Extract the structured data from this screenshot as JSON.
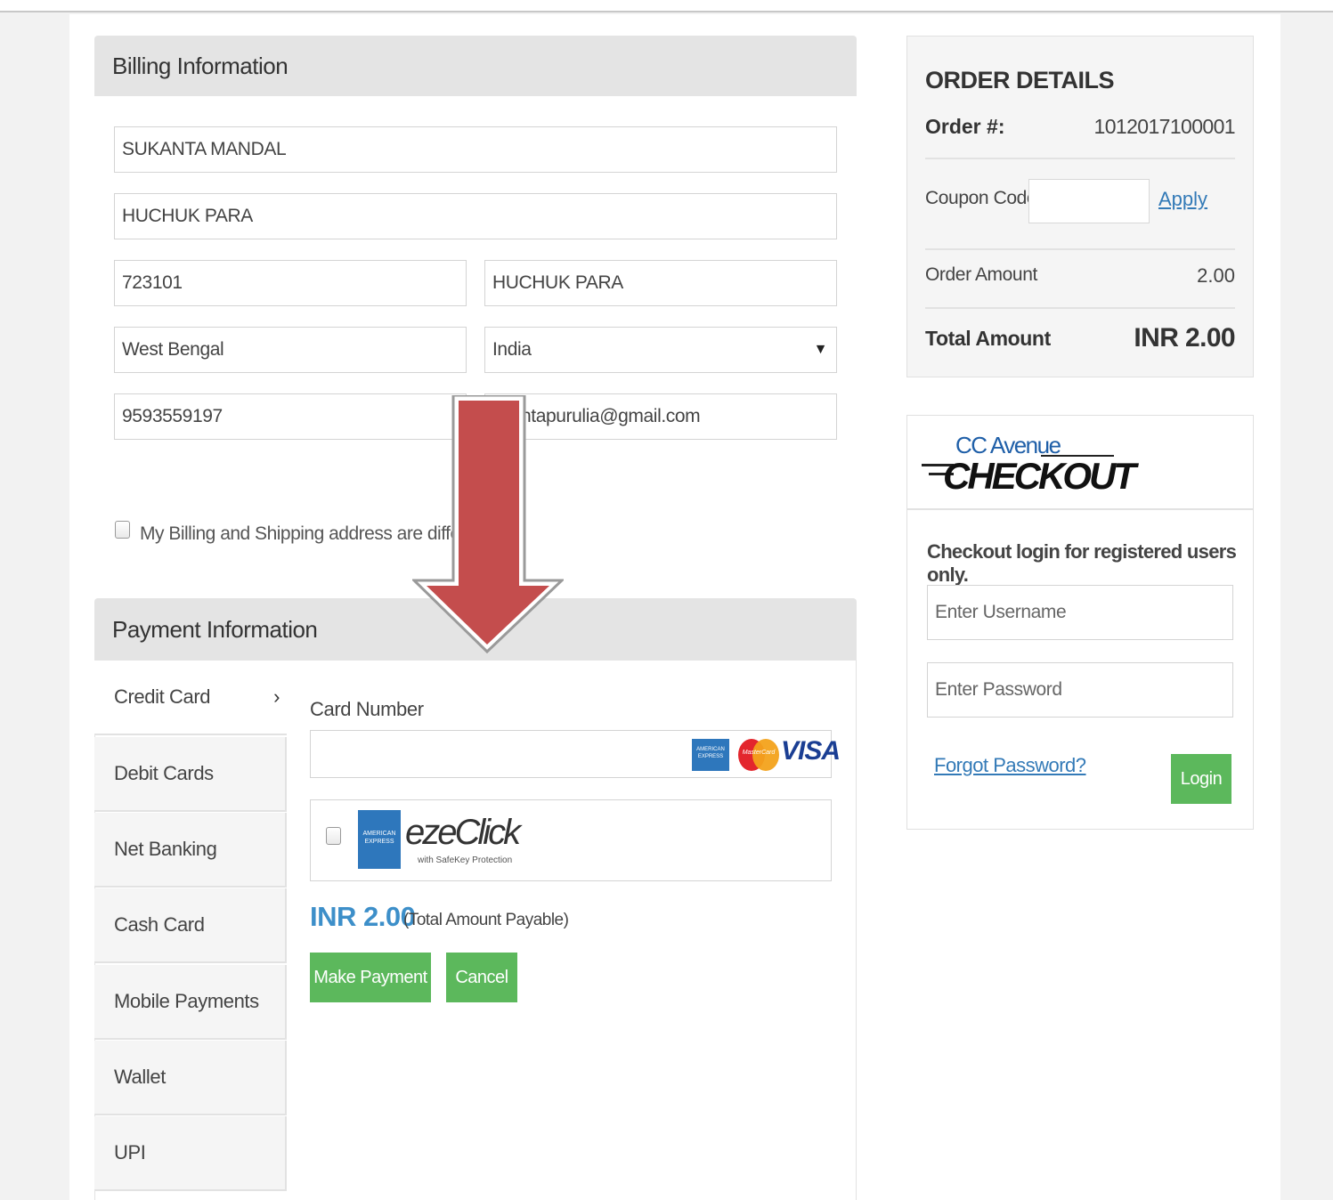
{
  "billing": {
    "title": "Billing Information",
    "name": "SUKANTA MANDAL",
    "address": "HUCHUK PARA",
    "zip": "723101",
    "city": "HUCHUK PARA",
    "state": "West Bengal",
    "country": "India",
    "phone": "9593559197",
    "email": "ntapurulia@gmail.com",
    "diff_address_label": "My Billing and Shipping address are different"
  },
  "payment": {
    "title": "Payment Information",
    "tabs": [
      "Credit Card",
      "Debit Cards",
      "Net Banking",
      "Cash Card",
      "Mobile Payments",
      "Wallet",
      "UPI"
    ],
    "card_number_label": "Card Number",
    "card_logos": [
      "AMERICAN EXPRESS",
      "MasterCard",
      "VISA"
    ],
    "ezeclick": {
      "brand": "ezeClick",
      "tagline": "with SafeKey Protection",
      "amex_text": "AMERICAN EXPRESS"
    },
    "amount": "INR 2.00",
    "amount_note": "(Total Amount Payable)",
    "make_payment_label": "Make Payment",
    "cancel_label": "Cancel"
  },
  "order": {
    "title": "ORDER DETAILS",
    "order_no_label": "Order #:",
    "order_no": "1012017100001",
    "coupon_label": "Coupon Code",
    "coupon_value": "",
    "apply_label": "Apply",
    "order_amount_label": "Order Amount",
    "order_amount": "2.00",
    "total_label": "Total Amount",
    "total_value": "INR 2.00"
  },
  "checkout": {
    "logo_top": "CC Avenue",
    "logo_main": "CHECKOUT",
    "subtitle": "Checkout login for registered users only.",
    "username_placeholder": "Enter Username",
    "password_placeholder": "Enter Password",
    "forgot_label": "Forgot Password?",
    "login_label": "Login"
  },
  "colors": {
    "green": "#5cb85c",
    "link": "#337ab7",
    "arrow_red": "#c44d4d",
    "amount_blue": "#3d8fc9"
  }
}
